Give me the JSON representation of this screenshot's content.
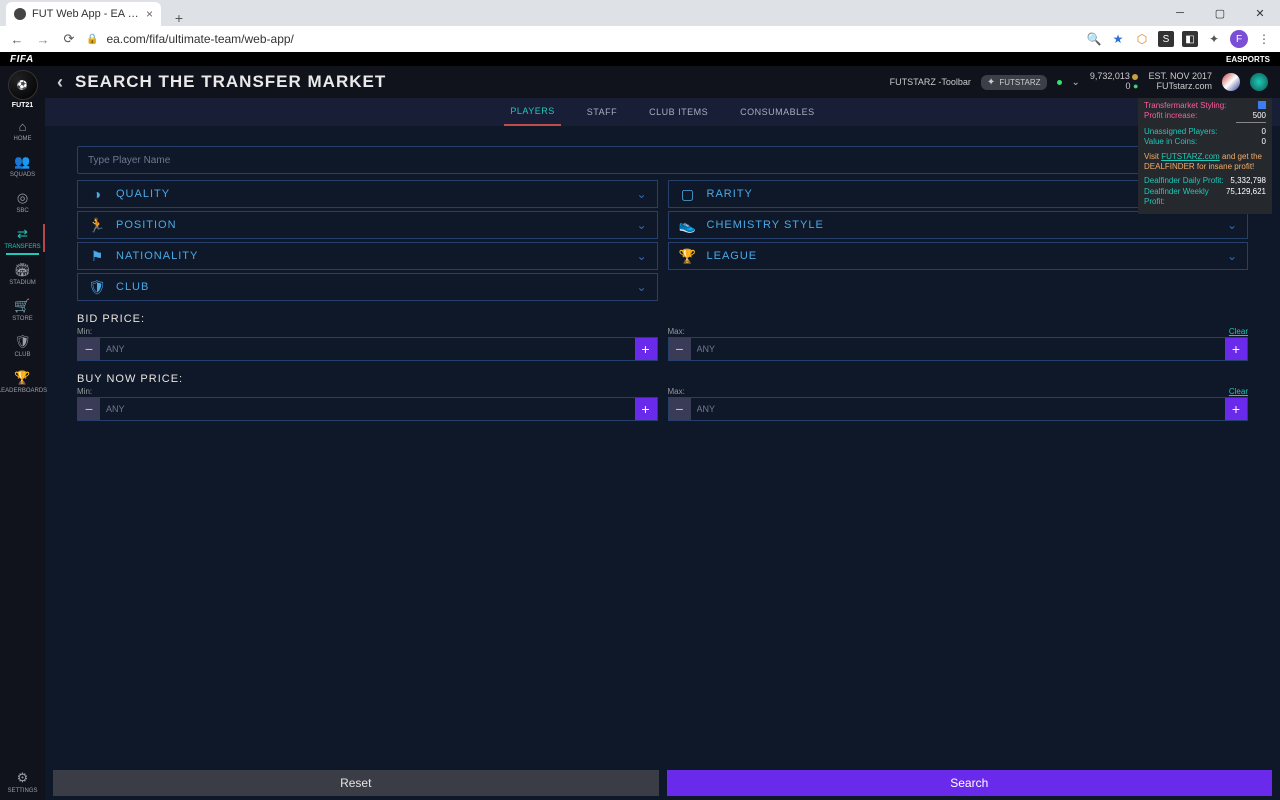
{
  "browser": {
    "tab_title": "FUT Web App - EA SPORTS Offic…",
    "url": "ea.com/fifa/ultimate-team/web-app/",
    "avatar_letter": "F"
  },
  "fifa_bar": {
    "logo": "FIFA",
    "brand": "EASPORTS"
  },
  "sidebar": {
    "logo_label": "FUT21",
    "items": [
      {
        "label": "HOME",
        "icon": "⌂"
      },
      {
        "label": "SQUADS",
        "icon": "👥"
      },
      {
        "label": "SBC",
        "icon": "◎"
      },
      {
        "label": "TRANSFERS",
        "icon": "⇄"
      },
      {
        "label": "STADIUM",
        "icon": "🏟"
      },
      {
        "label": "STORE",
        "icon": "🛒"
      },
      {
        "label": "CLUB",
        "icon": "🛡"
      },
      {
        "label": "LEADERBOARDS",
        "icon": "🏆"
      }
    ],
    "settings_label": "SETTINGS"
  },
  "header": {
    "title": "SEARCH THE TRANSFER MARKET",
    "toolbar_label": "FUTSTARZ -Toolbar",
    "futstarz_badge": "FUTSTARZ",
    "coins": "9,732,013",
    "points": "0",
    "est_label": "EST. NOV 2017",
    "domain": "FUTstarz.com"
  },
  "tabs": [
    {
      "label": "PLAYERS",
      "active": true
    },
    {
      "label": "STAFF",
      "active": false
    },
    {
      "label": "CLUB ITEMS",
      "active": false
    },
    {
      "label": "CONSUMABLES",
      "active": false
    }
  ],
  "search": {
    "placeholder": "Type Player Name",
    "filters_left": [
      {
        "label": "QUALITY",
        "icon": "◑"
      },
      {
        "label": "POSITION",
        "icon": "🏃"
      },
      {
        "label": "NATIONALITY",
        "icon": "⚑"
      },
      {
        "label": "CLUB",
        "icon": "🛡"
      }
    ],
    "filters_right": [
      {
        "label": "RARITY",
        "icon": "▢"
      },
      {
        "label": "CHEMISTRY STYLE",
        "icon": "👟"
      },
      {
        "label": "LEAGUE",
        "icon": "🏆"
      }
    ]
  },
  "prices": {
    "bid_label": "BID PRICE:",
    "buynow_label": "BUY NOW PRICE:",
    "min_label": "Min:",
    "max_label": "Max:",
    "clear_label": "Clear",
    "placeholder": "ANY"
  },
  "buttons": {
    "reset": "Reset",
    "search": "Search"
  },
  "overlay": {
    "styling_label": "Transfermarket Styling:",
    "profit_label": "Profit increase:",
    "profit_value": "500",
    "unassigned_label": "Unassigned Players:",
    "unassigned_value": "0",
    "valuecoins_label": "Value in Coins:",
    "valuecoins_value": "0",
    "visit_prefix": "Visit ",
    "visit_link": "FUTSTARZ.com",
    "visit_suffix": " and get the DEALFINDER for insane profit!",
    "daily_label": "Dealfinder Daily Profit:",
    "daily_value": "5,332,798",
    "weekly_label": "Dealfinder Weekly Profit:",
    "weekly_value": "75,129,621"
  }
}
